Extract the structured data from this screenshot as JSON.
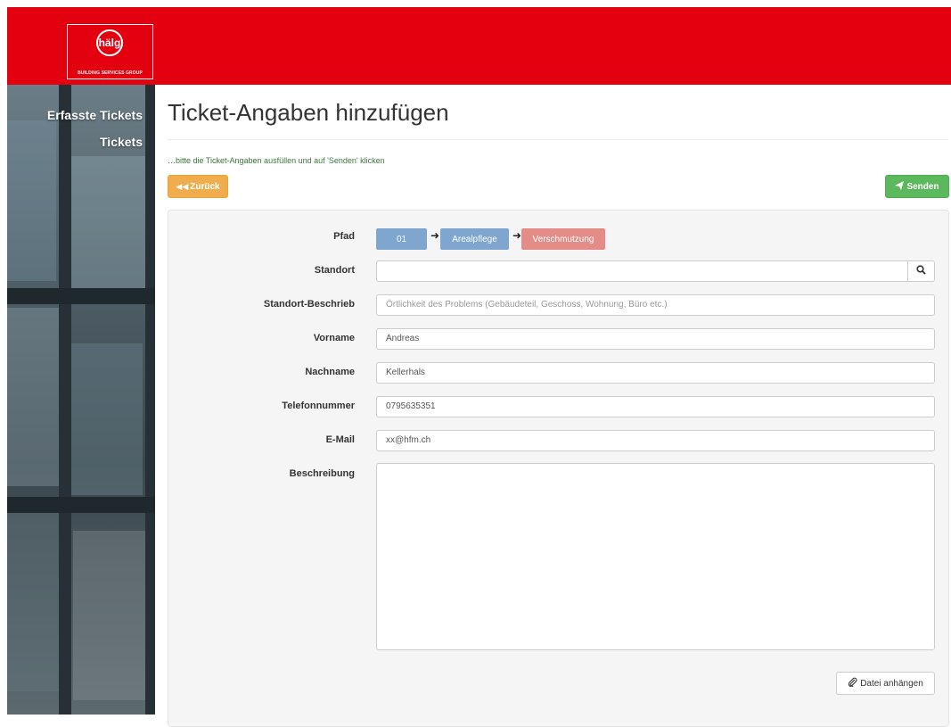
{
  "header": {
    "logo_mark": "hälg",
    "logo_subtitle": "BUILDING SERVICES GROUP",
    "brand_color": "#e3000f"
  },
  "sidebar": {
    "items": [
      {
        "label": "Erfasste Tickets"
      },
      {
        "label": "Tickets"
      }
    ]
  },
  "main": {
    "title": "Ticket-Angaben hinzufügen",
    "hint": "…bitte die Ticket-Angaben ausfüllen und auf 'Senden' klicken",
    "back_label": "Zurück",
    "back_icon": "double-left-arrow",
    "send_label": "Senden",
    "send_icon": "paper-plane",
    "back_color": "#f0ad4e",
    "send_color": "#5cb85c"
  },
  "form": {
    "path": {
      "label": "Pfad",
      "steps": [
        "01",
        "Arealpflege",
        "Verschmutzung"
      ],
      "step_colors": [
        "#7ea6cf",
        "#7ea6cf",
        "#e48c88"
      ]
    },
    "standort": {
      "label": "Standort",
      "value": "",
      "search_icon": "search"
    },
    "standort_beschrieb": {
      "label": "Standort-Beschrieb",
      "value": "",
      "placeholder": "Örtlichkeit des Problems (Gebäudeteil, Geschoss, Wohnung, Büro etc.)"
    },
    "vorname": {
      "label": "Vorname",
      "value": "Andreas"
    },
    "nachname": {
      "label": "Nachname",
      "value": "Kellerhals"
    },
    "telefon": {
      "label": "Telefonnummer",
      "value": "0795635351"
    },
    "email": {
      "label": "E-Mail",
      "value": "xx@hfm.ch"
    },
    "beschreibung": {
      "label": "Beschreibung",
      "value": ""
    },
    "attach_label": "Datei anhängen",
    "attach_icon": "paperclip"
  }
}
